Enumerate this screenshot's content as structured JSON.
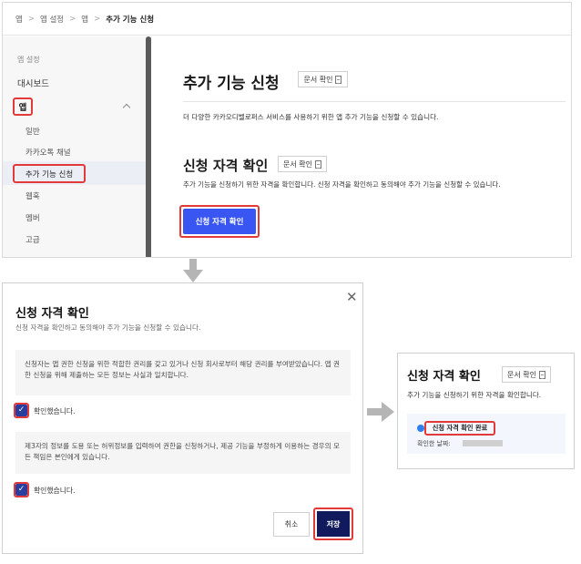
{
  "breadcrumb": {
    "app": "앱",
    "app_settings": "앱 설정",
    "app2": "앱",
    "current": "추가 기능 신청",
    "separator": ">"
  },
  "sidebar": {
    "section_title": "앱 설정",
    "dashboard": "대시보드",
    "app": "앱",
    "items": [
      "일반",
      "카카오톡 채널",
      "추가 기능 신청",
      "웹훅",
      "멤버",
      "고급"
    ]
  },
  "main": {
    "title": "추가 기능 신청",
    "doc_button": "문서 확인",
    "description": "더 다양한 카카오디벨로퍼스 서비스를 사용하기 위한 앱 추가 기능을 신청할 수 있습니다.",
    "section_title": "신청 자격 확인",
    "section_doc_button": "문서 확인",
    "section_desc": "추가 기능을 신청하기 위한 자격을 확인합니다. 신청 자격을 확인하고 동의해야 추가 기능을 신청할 수 있습니다.",
    "primary_button": "신청 자격 확인"
  },
  "modal": {
    "title": "신청 자격 확인",
    "subtitle": "신청 자격을 확인하고 동의해야 추가 기능을 신청할 수 있습니다.",
    "notice1": "신청자는 앱 권한 신청을 위한 적합한 권리를 갖고 있거나 신청 회사로부터 해당 권리를 부여받았습니다. 앱 권한 신청을 위해 제출하는 모든 정보는 사실과 일치합니다.",
    "check1": "확인했습니다.",
    "notice2": "제3자의 정보를 도용 또는 허위정보를 입력하여 권한을 신청하거나, 제공 기능을 부정하게 이용하는 경우의 모든 책임은 본인에게 있습니다.",
    "check2": "확인했습니다.",
    "cancel": "취소",
    "save": "저장"
  },
  "result": {
    "title": "신청 자격 확인",
    "doc_button": "문서 확인",
    "desc": "추가 기능을 신청하기 위한 자격을 확인합니다.",
    "status": "신청 자격 확인 완료",
    "date_label": "확인한 날짜:"
  },
  "colors": {
    "accent": "#3a56f2",
    "highlight": "#e23a3a",
    "save": "#101a5c",
    "check": "#2a3f9d",
    "status_dot": "#2f80ed"
  }
}
